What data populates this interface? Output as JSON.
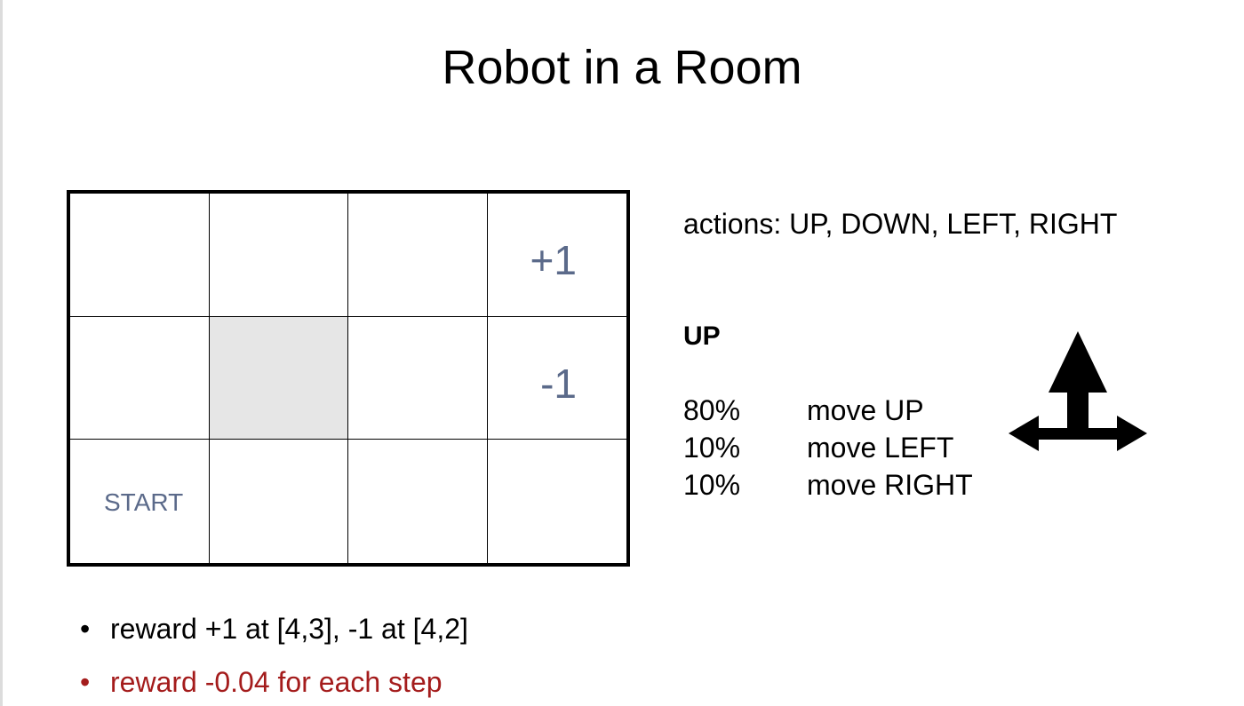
{
  "title": "Robot in a Room",
  "grid": {
    "cols": 4,
    "rows": 3,
    "cells": [
      {
        "row": 0,
        "col": 3,
        "label": "+1",
        "kind": "reward"
      },
      {
        "row": 1,
        "col": 1,
        "kind": "wall"
      },
      {
        "row": 1,
        "col": 3,
        "label": "-1",
        "kind": "reward"
      },
      {
        "row": 2,
        "col": 0,
        "label": "START",
        "kind": "start"
      }
    ]
  },
  "actions_text": "actions: UP, DOWN, LEFT, RIGHT",
  "up_heading": "UP",
  "transitions": [
    {
      "pct": "80%",
      "move": "move UP"
    },
    {
      "pct": "10%",
      "move": "move LEFT"
    },
    {
      "pct": "10%",
      "move": "move RIGHT"
    }
  ],
  "bullets": [
    {
      "text": "reward +1 at [4,3], -1 at [4,2]",
      "color": "#000000"
    },
    {
      "text": "reward -0.04 for each step",
      "color": "#a41c1c"
    }
  ],
  "icons": {
    "bullet": "•",
    "arrow": "up-left-right-arrow-icon"
  },
  "colors": {
    "cell_label": "#5b6a8a",
    "wall": "#e6e6e6",
    "highlight": "#a41c1c"
  }
}
